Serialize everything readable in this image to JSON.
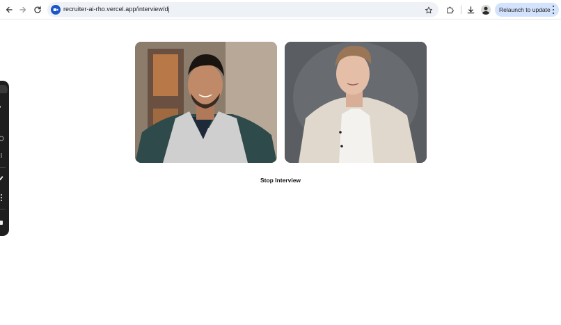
{
  "browser": {
    "url": "recruiter-ai-rho.vercel.app/interview/dj",
    "relaunch_label": "Relaunch to update"
  },
  "icons": {
    "back": "back-arrow-icon",
    "forward": "forward-arrow-icon",
    "reload": "reload-icon",
    "site": "video-camera-icon",
    "bookmark": "star-icon",
    "extensions": "puzzle-piece-icon",
    "downloads": "download-icon",
    "profile": "profile-avatar",
    "menu": "kebab-menu-icon"
  },
  "colors": {
    "accent": "#1a56c8",
    "relaunch_bg": "#d3e3fd",
    "panel_bg": "#1e1e1e"
  },
  "interview": {
    "stop_label": "Stop Interview",
    "participants": [
      {
        "role": "candidate-video"
      },
      {
        "role": "interviewer-avatar-video"
      }
    ]
  }
}
